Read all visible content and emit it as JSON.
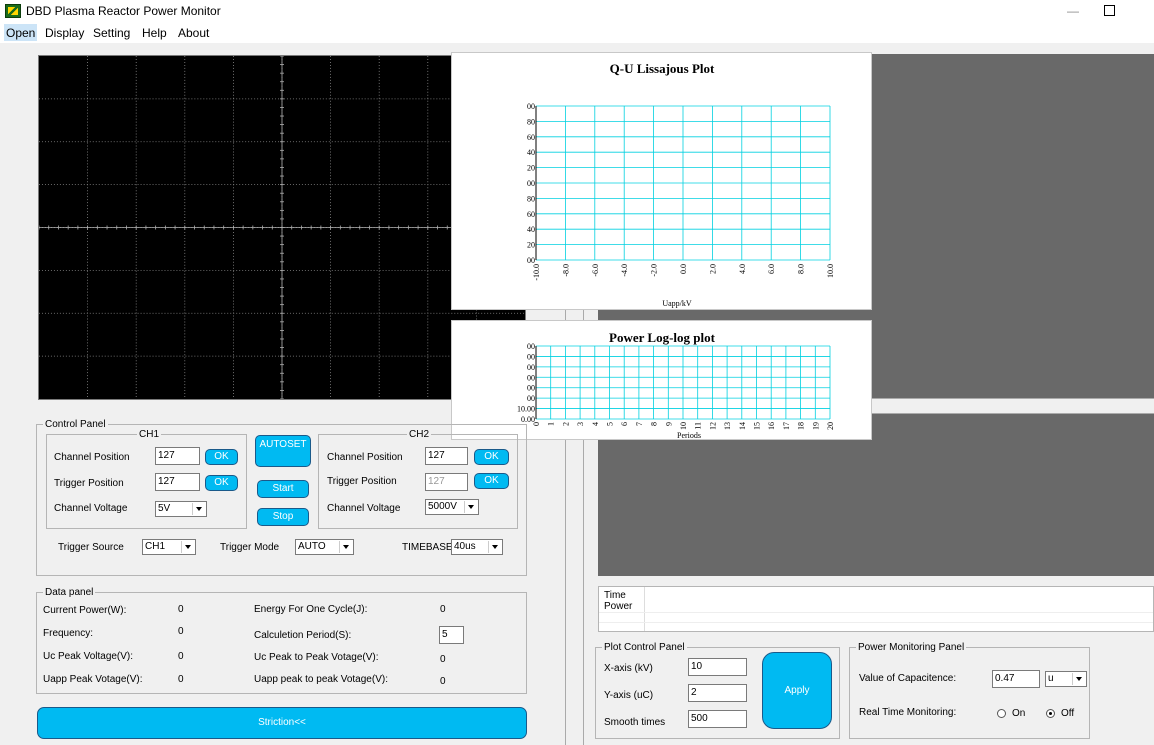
{
  "window": {
    "title": "DBD Plasma Reactor Power Monitor",
    "minimize_glyph": "—"
  },
  "menu": [
    "Open",
    "Display",
    "Setting",
    "Help",
    "About"
  ],
  "lissajous": {
    "title": "Q-U Lissajous Plot",
    "xlabel": "Uapp/kV",
    "x_ticks": [
      "-10.0",
      "-8.0",
      "-6.0",
      "-4.0",
      "-2.0",
      "0.0",
      "2.0",
      "4.0",
      "6.0",
      "8.0",
      "10.0"
    ],
    "y_ticks": [
      "00",
      "80",
      "60",
      "40",
      "20",
      "00",
      "80",
      "60",
      "40",
      "20",
      "00"
    ]
  },
  "powerplot": {
    "title": "Power Log-log plot",
    "xlabel": "Periods",
    "x_ticks": [
      "0",
      "1",
      "2",
      "3",
      "4",
      "5",
      "6",
      "7",
      "8",
      "9",
      "10",
      "11",
      "12",
      "13",
      "14",
      "15",
      "16",
      "17",
      "18",
      "19",
      "20"
    ],
    "y_ticks": [
      "00",
      "00",
      "00",
      "00",
      "00",
      "00",
      "10.00",
      "0.00"
    ]
  },
  "control_panel": {
    "title": "Control Panel",
    "ch1": {
      "title": "CH1",
      "channel_position_label": "Channel Position",
      "channel_position": "127",
      "trigger_position_label": "Trigger Position",
      "trigger_position": "127",
      "channel_voltage_label": "Channel  Voltage",
      "channel_voltage": "5V",
      "ok": "OK"
    },
    "ch2": {
      "title": "CH2",
      "channel_position_label": "Channel Position",
      "channel_position": "127",
      "trigger_position_label": "Trigger Position",
      "trigger_position": "127",
      "channel_voltage_label": "Channel  Voltage",
      "channel_voltage": "5000V",
      "ok": "OK"
    },
    "autoset": "AUTOSET",
    "start": "Start",
    "stop": "Stop",
    "trigger_source_label": "Trigger Source",
    "trigger_source": "CH1",
    "trigger_mode_label": "Trigger Mode",
    "trigger_mode": "AUTO",
    "timebase_label": "TIMEBASE",
    "timebase": "40us"
  },
  "data_panel": {
    "title": "Data panel",
    "current_power_label": "Current Power(W):",
    "current_power": "0",
    "frequency_label": "Frequency:",
    "frequency": "0",
    "uc_peak_label": "Uc Peak Voltage(V):",
    "uc_peak": "0",
    "uapp_peak_label": "Uapp Peak Votage(V):",
    "uapp_peak": "0",
    "energy_label": "Energy For One Cycle(J):",
    "energy": "0",
    "calc_period_label": "Calculetion Period(S):",
    "calc_period": "5",
    "uc_p2p_label": "Uc Peak to Peak Votage(V):",
    "uc_p2p": "0",
    "uapp_p2p_label": "Uapp peak to peak Votage(V):",
    "uapp_p2p": "0"
  },
  "striction_button": "Striction<<",
  "timepower": {
    "time_label": "Time",
    "power_label": "Power"
  },
  "plot_control": {
    "title": "Plot Control Panel",
    "x_axis_label": "X-axis (kV)",
    "x_axis": "10",
    "y_axis_label": "Y-axis (uC)",
    "y_axis": "2",
    "smooth_label": "Smooth times",
    "smooth": "500",
    "apply": "Apply"
  },
  "power_monitoring": {
    "title": "Power Monitoring Panel",
    "capacitance_label": "Value of Capacitence:",
    "capacitance": "0.47",
    "capacitance_unit": "u",
    "realtime_label": "Real Time Monitoring:",
    "on_label": "On",
    "off_label": "Off",
    "selected": "Off"
  },
  "colors": {
    "accent_button": "#00baf2",
    "grid_cyan": "#00d0e0",
    "scope_bg": "#000000",
    "panel_gray": "#696969"
  }
}
